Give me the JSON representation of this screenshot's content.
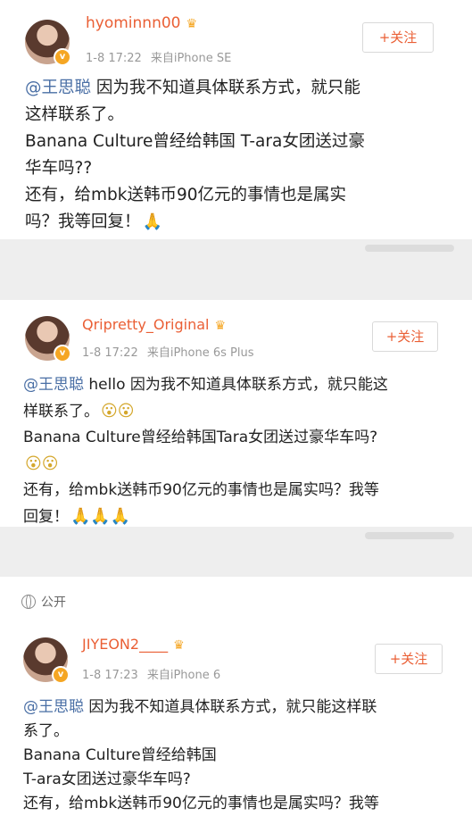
{
  "posts": [
    {
      "username": "hyominnn00",
      "time": "1-8 17:22",
      "source": "来自iPhone SE",
      "follow_label": "+关注",
      "mention": "@王思聪",
      "lines": [
        " 因为我不知道具体联系方式，就只能",
        "这样联系了。",
        "Banana Culture曾经给韩国 T-ara女团送过豪",
        "华车吗??",
        "还有，给mbk送韩币90亿元的事情也是属实",
        "吗？我等回复！"
      ]
    },
    {
      "username": "Qripretty_Original",
      "time": "1-8 17:22",
      "source": "来自iPhone 6s Plus",
      "follow_label": "+关注",
      "mention": "@王思聪",
      "lines": [
        " hello 因为我不知道具体联系方式，就只能这",
        "样联系了。",
        "Banana Culture曾经给韩国Tara女团送过豪华车吗?",
        "",
        "还有，给mbk送韩币90亿元的事情也是属实吗？我等",
        "回复！"
      ]
    },
    {
      "username": "JIYEON2____",
      "time": "1-8 17:23",
      "source": "来自iPhone 6",
      "follow_label": "+关注",
      "mention": "@王思聪",
      "lines": [
        " 因为我不知道具体联系方式，就只能这样联",
        "系了。",
        "Banana Culture曾经给韩国",
        "T-ara女团送过豪华车吗?",
        "还有，给mbk送韩币90亿元的事情也是属实吗？我等"
      ]
    }
  ],
  "public_label": "公开",
  "colors": {
    "username": "#ea5f35",
    "mention": "#4a6fa5",
    "meta": "#999999",
    "separator": "#eeeeee"
  }
}
